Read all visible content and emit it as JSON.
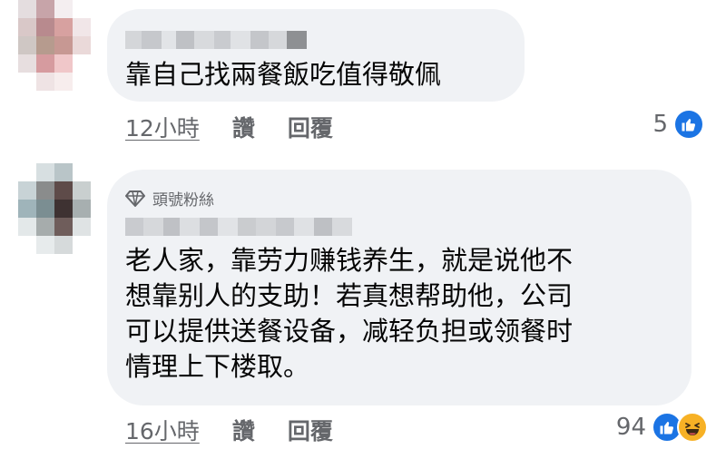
{
  "colors": {
    "bubble": "#f0f2f5",
    "secondary_text": "#65676b",
    "like_blue": "#1b74e4",
    "haha_yellow": "#f7b125"
  },
  "comments": [
    {
      "author": "(blurred)",
      "text": "靠自己找兩餐飯吃值得敬佩",
      "time": "12小時",
      "like_label": "讚",
      "reply_label": "回覆",
      "reaction_count": "5",
      "reactions": [
        "like-icon"
      ]
    },
    {
      "author": "(blurred)",
      "badge": "頭號粉絲",
      "badge_icon": "diamond-icon",
      "text": "老人家，靠劳力赚钱养生，就是说他不\n想靠别人的支助！若真想帮助他，公司\n可以提供送餐设备，减轻负担或领餐时\n情理上下楼取。",
      "time": "16小時",
      "like_label": "讚",
      "reply_label": "回覆",
      "reaction_count": "94",
      "reactions": [
        "like-icon",
        "haha-icon"
      ]
    }
  ]
}
